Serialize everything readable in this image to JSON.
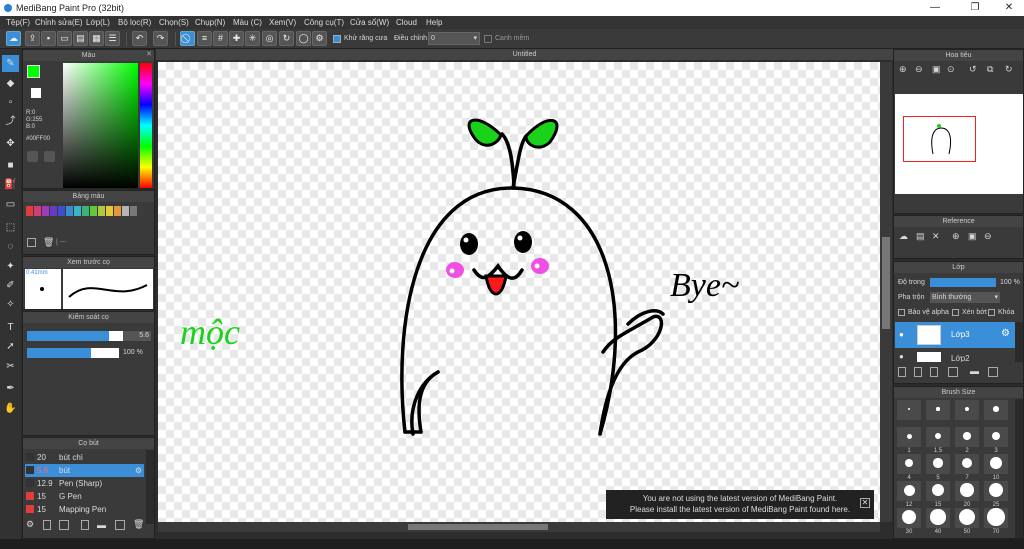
{
  "window": {
    "title": "MediBang Paint Pro (32bit)",
    "min": "—",
    "max": "❐",
    "close": "✕"
  },
  "menu": [
    "Tệp(F)",
    "Chỉnh sửa(E)",
    "Lớp(L)",
    "Bộ lọc(R)",
    "Chọn(S)",
    "Chụp(N)",
    "Màu (C)",
    "Xem(V)",
    "Công cụ(T)",
    "Cửa sổ(W)",
    "Cloud",
    "Help"
  ],
  "toolbar": {
    "antialias_label": "Khử răng cưa",
    "adjust_label": "Điều chỉnh",
    "adjust_value": "0",
    "smooth_label": "Canh mềm"
  },
  "panels": {
    "color": "Màu",
    "palette": "Bảng màu",
    "brush_preview": "Xem trước cọ",
    "brush_control": "Kiểm soát cọ",
    "brush": "Cọ bút",
    "navigator": "Hoa tiêu",
    "reference": "Reference",
    "layer": "Lớp",
    "brush_size": "Brush Size"
  },
  "color": {
    "r": "R:0",
    "g": "G:255",
    "b": "B:0",
    "hex": "#00FF00",
    "primary": "#00ff00",
    "secondary": "#ffffff"
  },
  "palette_colors": [
    "#e23c3c",
    "#d23c78",
    "#a03cb4",
    "#643cc8",
    "#3c50c8",
    "#3c8cd2",
    "#3cb4c8",
    "#3cb478",
    "#64c83c",
    "#b4c83c",
    "#e6c83c",
    "#e6963c",
    "#b4b4b4",
    "#787878",
    "#3c3c3c"
  ],
  "palette_extra": "| ---",
  "brush_preview": {
    "size": "0.41mm"
  },
  "brush_control": {
    "size": "5.6",
    "opacity": "100 %",
    "size_fill": 0.85,
    "opacity_fill": 0.7
  },
  "brushes": [
    {
      "size": "20",
      "name": "bút chì",
      "color": "#333333"
    },
    {
      "size": "5.6",
      "name": "bút",
      "color": "#333333",
      "selected": true
    },
    {
      "size": "12.9",
      "name": "Pen (Sharp)",
      "color": "#333333"
    },
    {
      "size": "15",
      "name": "G Pen",
      "color": "#e23c3c"
    },
    {
      "size": "15",
      "name": "Mapping Pen",
      "color": "#e23c3c"
    }
  ],
  "canvas": {
    "tab": "Untitled",
    "text_left": "mộc",
    "text_right": "Bye~"
  },
  "notice": {
    "line1": "You are not using the latest version of MediBang Paint.",
    "line2": "Please install the latest version of MediBang Paint found here.",
    "close": "✕"
  },
  "layer": {
    "opacity_label": "Độ trong",
    "opacity_value": "100 %",
    "blend_label": "Pha trộn",
    "blend_value": "Bình thường",
    "protect_alpha": "Bảo vệ alpha",
    "clipping": "Xén bớt",
    "lock": "Khóa",
    "layers": [
      {
        "name": "Lớp3",
        "selected": true
      },
      {
        "name": "Lớp2"
      }
    ]
  },
  "brush_sizes": [
    "",
    "",
    "",
    "",
    "1",
    "1.5",
    "2",
    "3",
    "4",
    "5",
    "7",
    "10",
    "12",
    "15",
    "20",
    "25",
    "30",
    "40",
    "50",
    "70"
  ]
}
